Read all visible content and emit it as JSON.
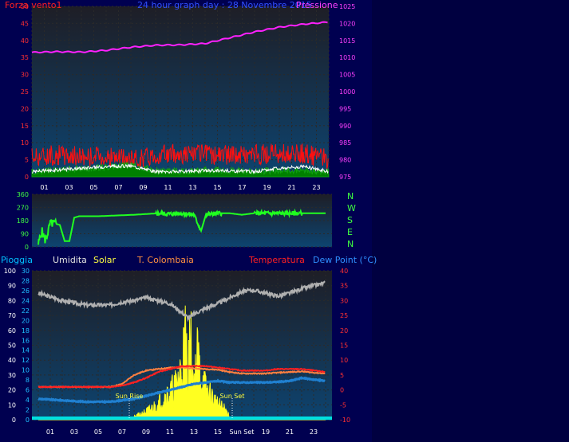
{
  "titles": {
    "wind": "Forza vento1",
    "date": "24 hour graph day : 28 Novembre 2015",
    "pressure": "Pressione"
  },
  "legend": {
    "rain": "Pioggia",
    "humidity": "Umidita",
    "solar": "Solar",
    "city": "T. Colombaia",
    "temperature": "Temperatura",
    "dewpoint": "Dew Point (°C)"
  },
  "sun": {
    "rise_label": "Sun Rise",
    "set_label": "Sun Set",
    "rise_hour": 7.6,
    "set_hour": 16.2
  },
  "colors": {
    "wind_gust": "#ff1010",
    "wind_speed": "#008000",
    "pressure": "#ff20ff",
    "direction": "#20ff20",
    "humidity": "#b0b0b0",
    "temperature": "#ff2020",
    "dewpoint": "#2080d0",
    "city_temp": "#ff8040",
    "solar": "#ffff20",
    "rain": "#00e0e0"
  },
  "chart_data": [
    {
      "type": "line",
      "title": "24 hour graph day : 28 Novembre 2015",
      "x_ticks": [
        "01",
        "03",
        "05",
        "07",
        "09",
        "11",
        "13",
        "15",
        "17",
        "19",
        "21",
        "23"
      ],
      "left_axis": {
        "label": "Forza vento1",
        "ticks": [
          0,
          5,
          10,
          15,
          20,
          25,
          30,
          35,
          40,
          45,
          50
        ],
        "range": [
          0,
          50
        ]
      },
      "right_axis": {
        "label": "Pressione",
        "ticks": [
          975,
          980,
          985,
          990,
          995,
          1000,
          1005,
          1010,
          1015,
          1020,
          1025
        ],
        "range": [
          975,
          1025
        ]
      },
      "series": [
        {
          "name": "Pressione",
          "axis": "right",
          "x": [
            0,
            2,
            4,
            6,
            8,
            10,
            12,
            14,
            16,
            18,
            20,
            22,
            24
          ],
          "values": [
            1011.5,
            1011.7,
            1011.6,
            1012.1,
            1013.0,
            1013.6,
            1013.7,
            1014.1,
            1015.8,
            1017.5,
            1018.9,
            1019.8,
            1020.4
          ]
        }
      ],
      "gust_series": {
        "x": [
          0,
          2,
          4,
          6,
          8,
          10,
          12,
          14,
          16,
          18,
          20,
          22,
          24
        ],
        "values": [
          6,
          6.5,
          6,
          6,
          5,
          6.5,
          6.8,
          6.5,
          6.5,
          6.5,
          7,
          6.8,
          5
        ]
      },
      "wind_series": {
        "x": [
          0,
          2,
          4,
          6,
          8,
          10,
          12,
          14,
          16,
          18,
          20,
          22,
          24
        ],
        "values": [
          1,
          1.5,
          2,
          2.5,
          3,
          1.5,
          1.2,
          1.5,
          1.5,
          1.2,
          1.5,
          1.5,
          1
        ]
      },
      "avg_series": {
        "x": [
          0,
          2,
          4,
          6,
          8,
          10,
          12,
          14,
          16,
          18,
          20,
          22,
          24
        ],
        "values": [
          1.5,
          2,
          2.5,
          3,
          3.2,
          1.5,
          1.5,
          1.8,
          1.8,
          1.5,
          2.5,
          3,
          1.5
        ]
      }
    },
    {
      "type": "line",
      "left_axis": {
        "ticks": [
          0,
          90,
          180,
          270,
          360
        ],
        "range": [
          0,
          360
        ]
      },
      "compass": [
        "N",
        "W",
        "S",
        "E",
        "N"
      ],
      "series": [
        {
          "name": "direction",
          "x": [
            0,
            0.3,
            0.6,
            1.0,
            1.4,
            1.8,
            2.2,
            2.6,
            3.0,
            3.4,
            5.0,
            8.0,
            10.0,
            11.0,
            12.0,
            13.0,
            13.6,
            14.0,
            15.0,
            16.0,
            17.0,
            18.0,
            20.0,
            22.0,
            24.0
          ],
          "values": [
            20,
            110,
            40,
            160,
            160,
            150,
            40,
            40,
            200,
            210,
            210,
            220,
            230,
            225,
            230,
            220,
            110,
            220,
            230,
            230,
            220,
            230,
            230,
            230,
            230
          ]
        }
      ]
    },
    {
      "type": "line",
      "x_ticks": [
        "01",
        "03",
        "05",
        "07",
        "09",
        "11",
        "13",
        "15",
        "Sun Set",
        "19",
        "21",
        "23"
      ],
      "humidity_axis": {
        "ticks": [
          0,
          10,
          20,
          30,
          40,
          50,
          60,
          70,
          80,
          90,
          100
        ],
        "range": [
          0,
          100
        ]
      },
      "rain_axis": {
        "ticks": [
          0,
          2,
          4,
          6,
          8,
          10,
          12,
          14,
          16,
          18,
          20,
          22,
          24,
          26,
          28,
          30
        ],
        "range": [
          0,
          30
        ]
      },
      "temp_axis": {
        "ticks": [
          -10,
          -5,
          0,
          5,
          10,
          15,
          20,
          25,
          30,
          35,
          40
        ],
        "range": [
          -10,
          40
        ]
      },
      "series": [
        {
          "name": "Umidita",
          "axis": "humidity",
          "x": [
            0,
            2,
            4,
            6,
            7,
            8,
            9,
            10,
            11,
            12,
            12.6,
            13,
            14,
            15,
            16,
            17,
            18,
            19,
            20,
            21,
            22,
            23,
            24
          ],
          "values": [
            85,
            80,
            77,
            77,
            79,
            80,
            82,
            80,
            78,
            72,
            68,
            71,
            75,
            78,
            82,
            86,
            87,
            85,
            83,
            85,
            88,
            90,
            92
          ]
        },
        {
          "name": "Dew Point",
          "axis": "temp",
          "x": [
            0,
            2,
            4,
            6,
            7,
            8,
            9,
            10,
            11,
            12,
            13,
            14,
            15,
            16,
            17,
            18,
            19,
            20,
            21,
            22,
            23,
            24
          ],
          "values": [
            -3,
            -3.5,
            -4,
            -4,
            -3.5,
            -3,
            -2,
            -1,
            0,
            1,
            2,
            2.5,
            3,
            2.5,
            2.5,
            2.5,
            2.5,
            2.7,
            3,
            4,
            3.5,
            3
          ]
        },
        {
          "name": "T. Colombaia",
          "axis": "temp",
          "x": [
            0,
            2,
            4,
            6,
            7,
            8,
            9,
            10,
            11,
            12,
            13,
            14,
            15,
            16,
            17,
            18,
            19,
            20,
            21,
            22,
            23,
            24
          ],
          "values": [
            1,
            1,
            1,
            1,
            2,
            5,
            6.5,
            7,
            7.5,
            7.5,
            7.2,
            7,
            6.8,
            6,
            5.5,
            5.5,
            5.5,
            5.8,
            6,
            6.2,
            5.8,
            5.5
          ]
        },
        {
          "name": "Temperatura",
          "axis": "temp",
          "x": [
            0,
            2,
            4,
            6,
            7,
            8,
            9,
            10,
            11,
            12,
            13,
            14,
            15,
            16,
            17,
            18,
            19,
            20,
            21,
            22,
            23,
            24
          ],
          "values": [
            1,
            1,
            1,
            1,
            1.5,
            2.5,
            4,
            6,
            7,
            8,
            8,
            8,
            7.5,
            7,
            6.5,
            6.5,
            6.5,
            7,
            7,
            7,
            6.5,
            6
          ]
        },
        {
          "name": "Solar",
          "axis": "rain",
          "x": [
            0,
            7.6,
            8.2,
            9.0,
            10.0,
            10.5,
            11.0,
            11.5,
            12.0,
            12.3,
            12.5,
            12.7,
            13.0,
            13.3,
            13.6,
            14.0,
            14.5,
            15.0,
            15.5,
            16.0,
            16.2,
            24
          ],
          "values": [
            0,
            0,
            1,
            2,
            4,
            6,
            7,
            9,
            14,
            22,
            12,
            21,
            9,
            17,
            11,
            8,
            6,
            4,
            3,
            1,
            0,
            0
          ]
        }
      ]
    }
  ]
}
